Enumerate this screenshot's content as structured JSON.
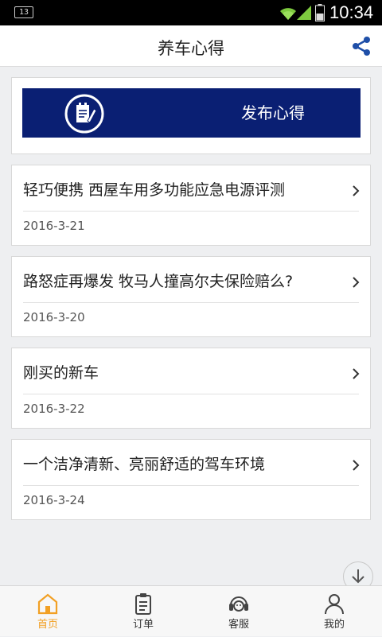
{
  "status_bar": {
    "notification_count": "13",
    "time": "10:34"
  },
  "header": {
    "title": "养车心得",
    "share_icon": "share-icon"
  },
  "publish": {
    "label": "发布心得",
    "icon": "edit-document-icon",
    "banner_color": "#0a1f73"
  },
  "posts": [
    {
      "title": "轻巧便携 西屋车用多功能应急电源评测",
      "date": "2016-3-21"
    },
    {
      "title": "路怒症再爆发 牧马人撞高尔夫保险赔么?",
      "date": "2016-3-20"
    },
    {
      "title": "刚买的新车",
      "date": "2016-3-22"
    },
    {
      "title": "一个洁净清新、亮丽舒适的驾车环境",
      "date": "2016-3-24"
    }
  ],
  "bottom_nav": {
    "items": [
      {
        "label": "首页",
        "icon": "home-icon",
        "active": true
      },
      {
        "label": "订单",
        "icon": "clipboard-icon",
        "active": false
      },
      {
        "label": "客服",
        "icon": "headset-icon",
        "active": false
      },
      {
        "label": "我的",
        "icon": "user-icon",
        "active": false
      }
    ]
  },
  "colors": {
    "accent": "#f2a024",
    "header_icon": "#1f4fa8",
    "background": "#eeeff1"
  }
}
